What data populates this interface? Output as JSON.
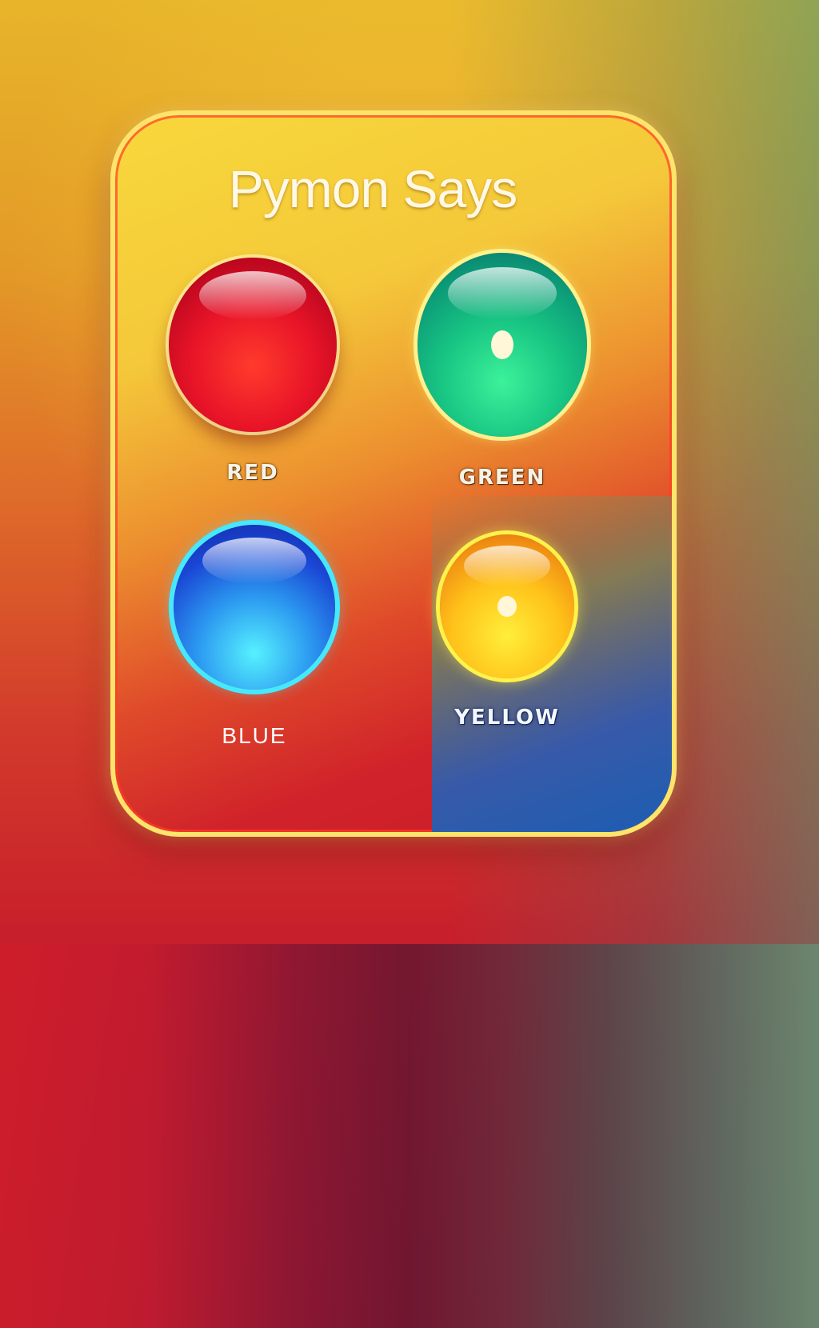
{
  "title": "Pymon Says",
  "buttons": [
    {
      "label": "RED",
      "color": "#e81428"
    },
    {
      "label": "GREEN",
      "color": "#18c583"
    },
    {
      "label": "BLUE",
      "color": "#1a46d4"
    },
    {
      "label": "YELLOW",
      "color": "#ffc21a"
    }
  ],
  "colors": {
    "board_top": "#f8d83b",
    "board_bottom": "#c81f2b",
    "board_border": "#fde46a"
  }
}
